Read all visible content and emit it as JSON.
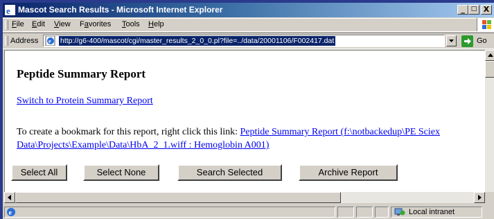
{
  "window": {
    "title": "Mascot Search Results - Microsoft Internet Explorer",
    "controls": [
      "_",
      "□",
      "X"
    ]
  },
  "menu": {
    "items": [
      {
        "label": "File",
        "accel": "F",
        "rest": "ile"
      },
      {
        "label": "Edit",
        "accel": "E",
        "rest": "dit"
      },
      {
        "label": "View",
        "accel": "V",
        "rest": "iew"
      },
      {
        "label": "Favorites",
        "accel": "a",
        "pre": "F",
        "rest": "vorites"
      },
      {
        "label": "Tools",
        "accel": "T",
        "rest": "ools"
      },
      {
        "label": "Help",
        "accel": "H",
        "rest": "elp"
      }
    ]
  },
  "address": {
    "label": "Address",
    "url": "http://g6-400/mascot/cgi/master_results_2_0_0.pl?file=../data/20001106/F002417.dat",
    "go_label": "Go"
  },
  "page": {
    "heading": "Peptide Summary Report",
    "switch_link": "Switch to Protein Summary Report",
    "bookmark_prefix": "To create a bookmark for this report, right click this link: ",
    "bookmark_link": "Peptide Summary Report (f:\\notbackedup\\PE Sciex Data\\Projects\\Example\\Data\\HbA_2_1.wiff : Hemoglobin A001)",
    "buttons": {
      "select_all": "Select All",
      "select_none": "Select None",
      "search_selected": "Search Selected",
      "archive_report": "Archive Report"
    }
  },
  "status": {
    "zone": "Local intranet"
  },
  "colors": {
    "title_start": "#0a246a",
    "title_end": "#a6caf0",
    "link": "#0000ee",
    "chrome": "#d4d0c8"
  }
}
